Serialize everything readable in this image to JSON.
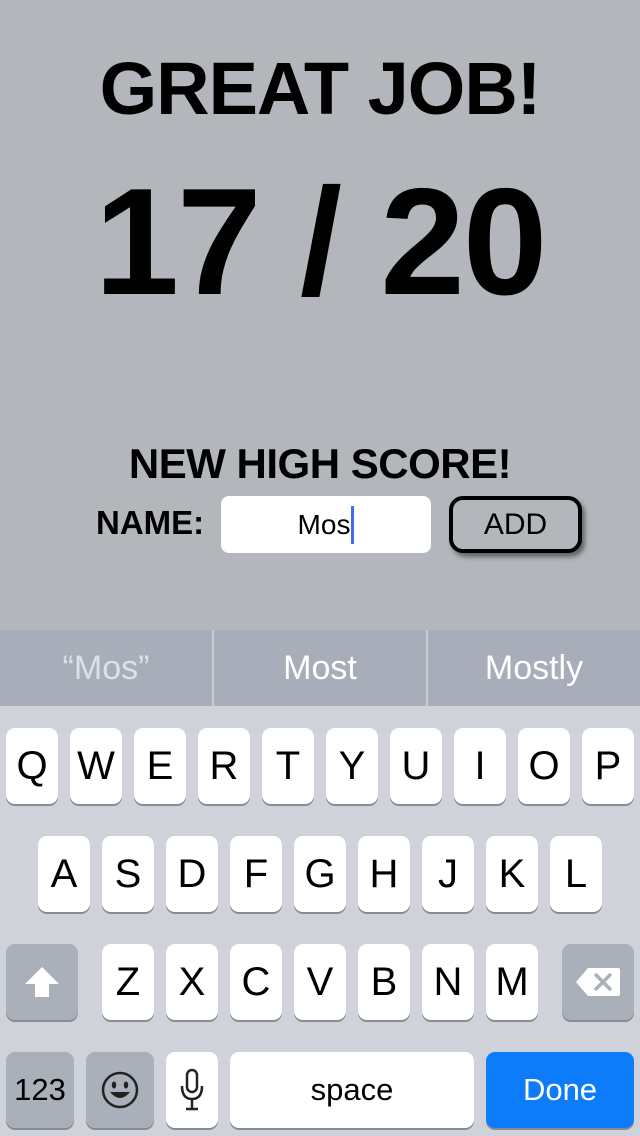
{
  "screen": {
    "headline": "GREAT JOB!",
    "score": "17 / 20",
    "high_score": "NEW HIGH SCORE!",
    "name_label": "NAME:",
    "name_value": "Mos",
    "add_label": "ADD"
  },
  "suggestions": [
    "“Mos”",
    "Most",
    "Mostly"
  ],
  "keyboard": {
    "row1": [
      "Q",
      "W",
      "E",
      "R",
      "T",
      "Y",
      "U",
      "I",
      "O",
      "P"
    ],
    "row2": [
      "A",
      "S",
      "D",
      "F",
      "G",
      "H",
      "J",
      "K",
      "L"
    ],
    "row3": [
      "Z",
      "X",
      "C",
      "V",
      "B",
      "N",
      "M"
    ],
    "numbers_label": "123",
    "space_label": "space",
    "done_label": "Done",
    "icons": {
      "shift": "shift-arrow-icon",
      "backspace": "backspace-icon",
      "emoji": "emoji-icon",
      "dictation": "microphone-icon"
    },
    "accent_color": "#0d7cfb"
  }
}
